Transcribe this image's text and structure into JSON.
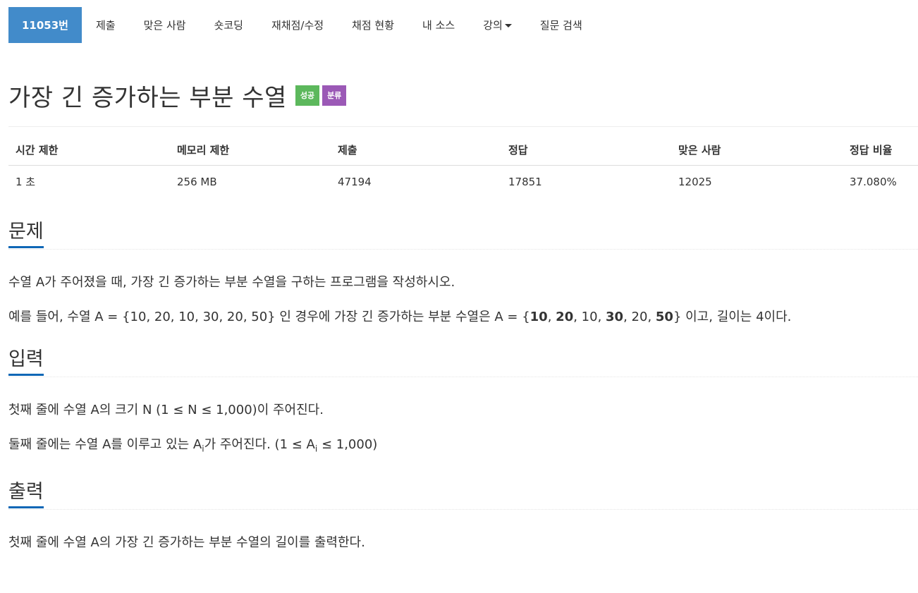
{
  "nav": {
    "items": [
      {
        "label": "11053번"
      },
      {
        "label": "제출"
      },
      {
        "label": "맞은 사람"
      },
      {
        "label": "숏코딩"
      },
      {
        "label": "재채점/수정"
      },
      {
        "label": "채점 현황"
      },
      {
        "label": "내 소스"
      },
      {
        "label": "강의"
      },
      {
        "label": "질문 검색"
      }
    ]
  },
  "problem": {
    "title": "가장 긴 증가하는 부분 수열",
    "badge_success": "성공",
    "badge_category": "분류"
  },
  "stats": {
    "headers": [
      "시간 제한",
      "메모리 제한",
      "제출",
      "정답",
      "맞은 사람",
      "정답 비율"
    ],
    "values": [
      "1 초",
      "256 MB",
      "47194",
      "17851",
      "12025",
      "37.080%"
    ]
  },
  "sections": {
    "description": {
      "heading": "문제",
      "line1": "수열 A가 주어졌을 때, 가장 긴 증가하는 부분 수열을 구하는 프로그램을 작성하시오.",
      "line2_prefix": "예를 들어, 수열 A = {10, 20, 10, 30, 20, 50} 인 경우에 가장 긴 증가하는 부분 수열은 A = {",
      "seq_b1": "10",
      "sep1": ", ",
      "seq_b2": "20",
      "seq_mid1": ", 10, ",
      "seq_b3": "30",
      "seq_mid2": ", 20, ",
      "seq_b4": "50",
      "line2_suffix": "} 이고, 길이는 4이다."
    },
    "input": {
      "heading": "입력",
      "line1": "첫째 줄에 수열 A의 크기 N (1 ≤ N ≤ 1,000)이 주어진다.",
      "line2_a": "둘째 줄에는 수열 A를 이루고 있는 A",
      "line2_sub1": "i",
      "line2_b": "가 주어진다. (1 ≤ A",
      "line2_sub2": "i",
      "line2_c": " ≤ 1,000)"
    },
    "output": {
      "heading": "출력",
      "line1": "첫째 줄에 수열 A의 가장 긴 증가하는 부분 수열의 길이를 출력한다."
    }
  }
}
